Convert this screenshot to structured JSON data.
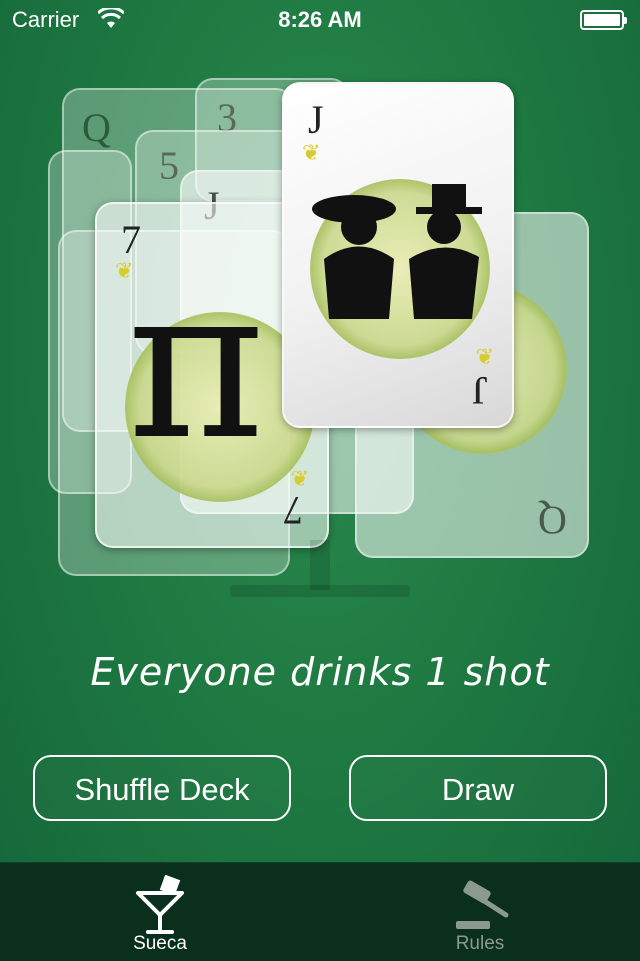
{
  "status": {
    "carrier": "Carrier",
    "time": "8:26 AM"
  },
  "cards": {
    "front_rank": "J",
    "middle_rank": "7",
    "back_rank": "Q",
    "ghost_rank_a": "3",
    "ghost_rank_b": "5",
    "ghost_rank_c": "J"
  },
  "message": "Everyone drinks 1 shot",
  "buttons": {
    "shuffle": "Shuffle Deck",
    "draw": "Draw"
  },
  "tabs": [
    {
      "label": "Sueca",
      "icon": "cocktail-glass-icon",
      "selected": true
    },
    {
      "label": "Rules",
      "icon": "gavel-icon",
      "selected": false
    }
  ],
  "colors": {
    "background": "#1f7a42",
    "tab_bar": "#0a2f1c",
    "tab_selected": "#ffffff",
    "tab_unselected": "#8a9a8f"
  }
}
